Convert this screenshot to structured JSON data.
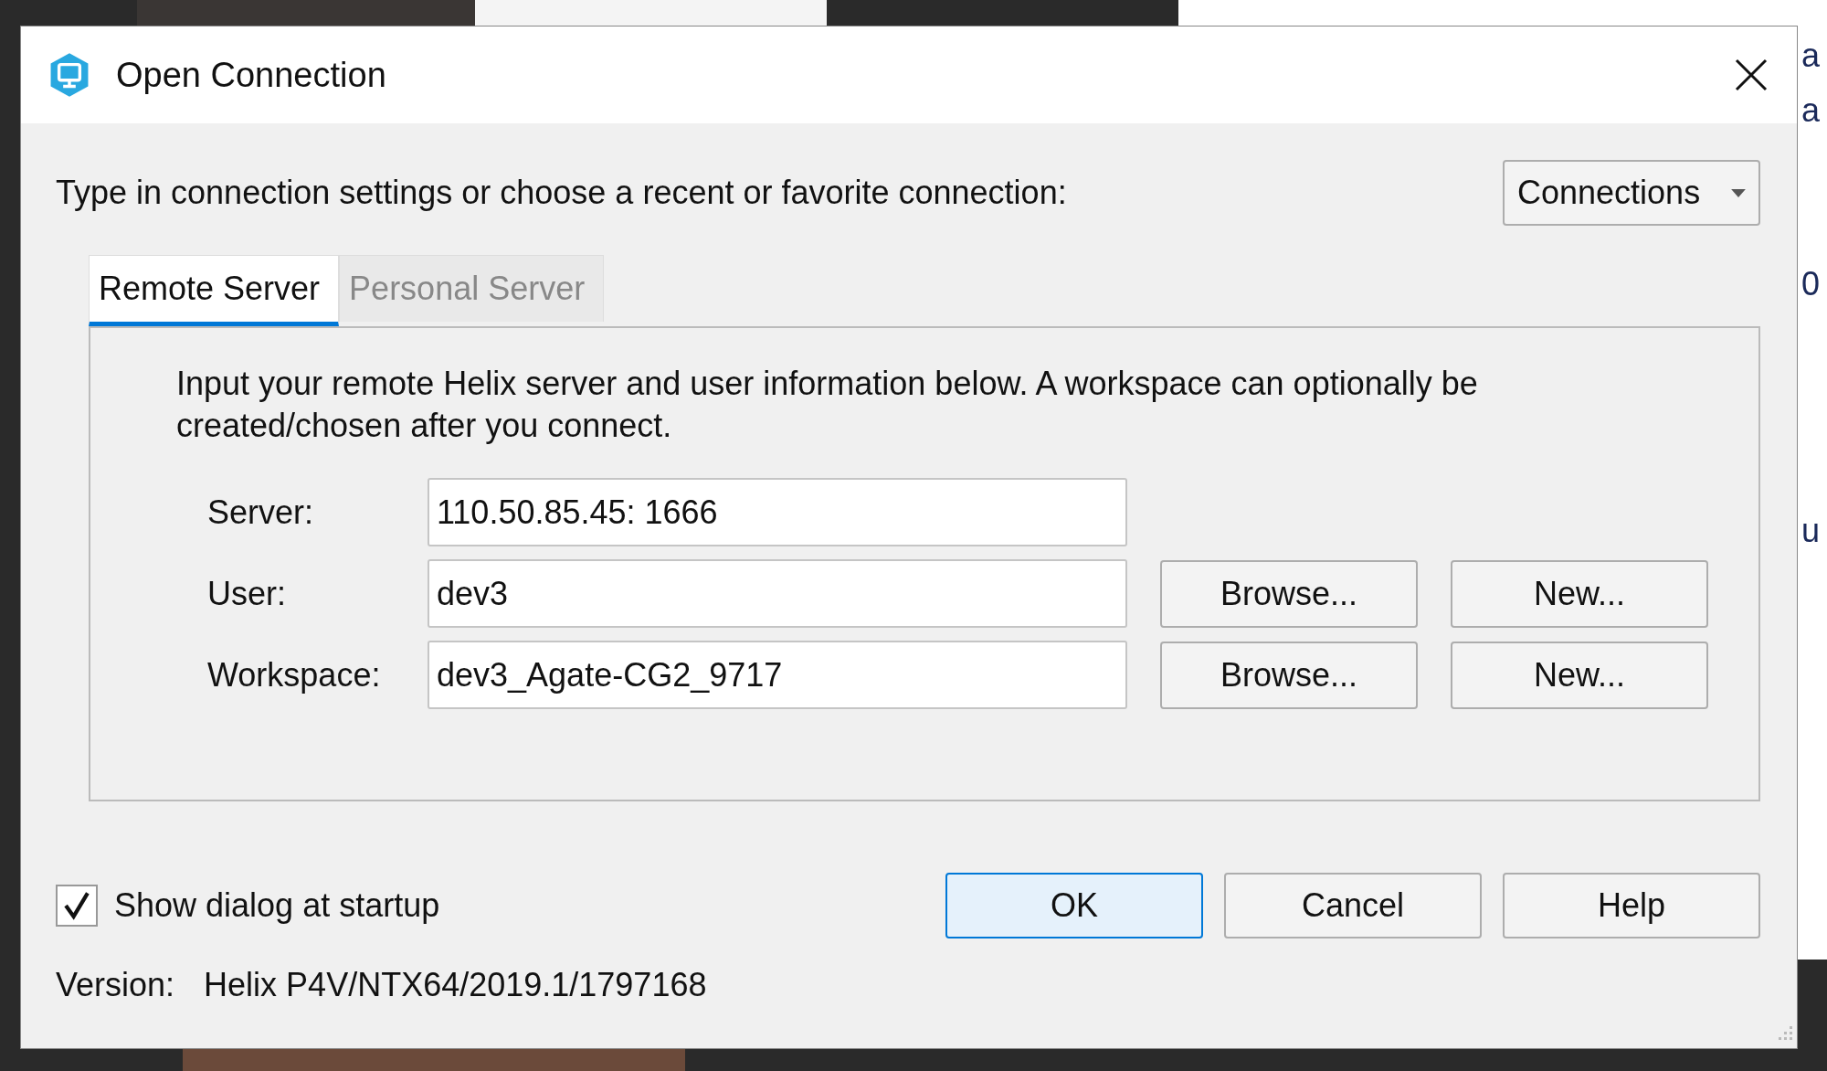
{
  "window": {
    "title": "Open Connection"
  },
  "prompt": "Type in connection settings or choose a recent or favorite connection:",
  "connections_button": {
    "label": "Connections"
  },
  "tabs": [
    {
      "label": "Remote Server",
      "selected": true
    },
    {
      "label": "Personal Server",
      "selected": false
    }
  ],
  "description": "Input your remote Helix server and user information below. A workspace can optionally be created/chosen after you connect.",
  "fields": [
    {
      "label": "Server:",
      "value": "110.50.85.45: 1666"
    },
    {
      "label": "User:",
      "value": "dev3",
      "buttons": [
        {
          "label": "Browse..."
        },
        {
          "label": "New..."
        }
      ]
    },
    {
      "label": "Workspace:",
      "value": "dev3_Agate-CG2_9717",
      "buttons": [
        {
          "label": "Browse..."
        },
        {
          "label": "New..."
        }
      ]
    }
  ],
  "show_at_startup": {
    "label": "Show dialog at startup",
    "checked": true
  },
  "dialog_buttons": [
    {
      "label": "OK",
      "default": true
    },
    {
      "label": "Cancel",
      "default": false
    },
    {
      "label": "Help",
      "default": false
    }
  ],
  "version": {
    "label": "Version:",
    "value": "Helix P4V/NTX64/2019.1/1797168"
  },
  "background_fragments": [
    "a",
    "a",
    "0",
    "u"
  ]
}
